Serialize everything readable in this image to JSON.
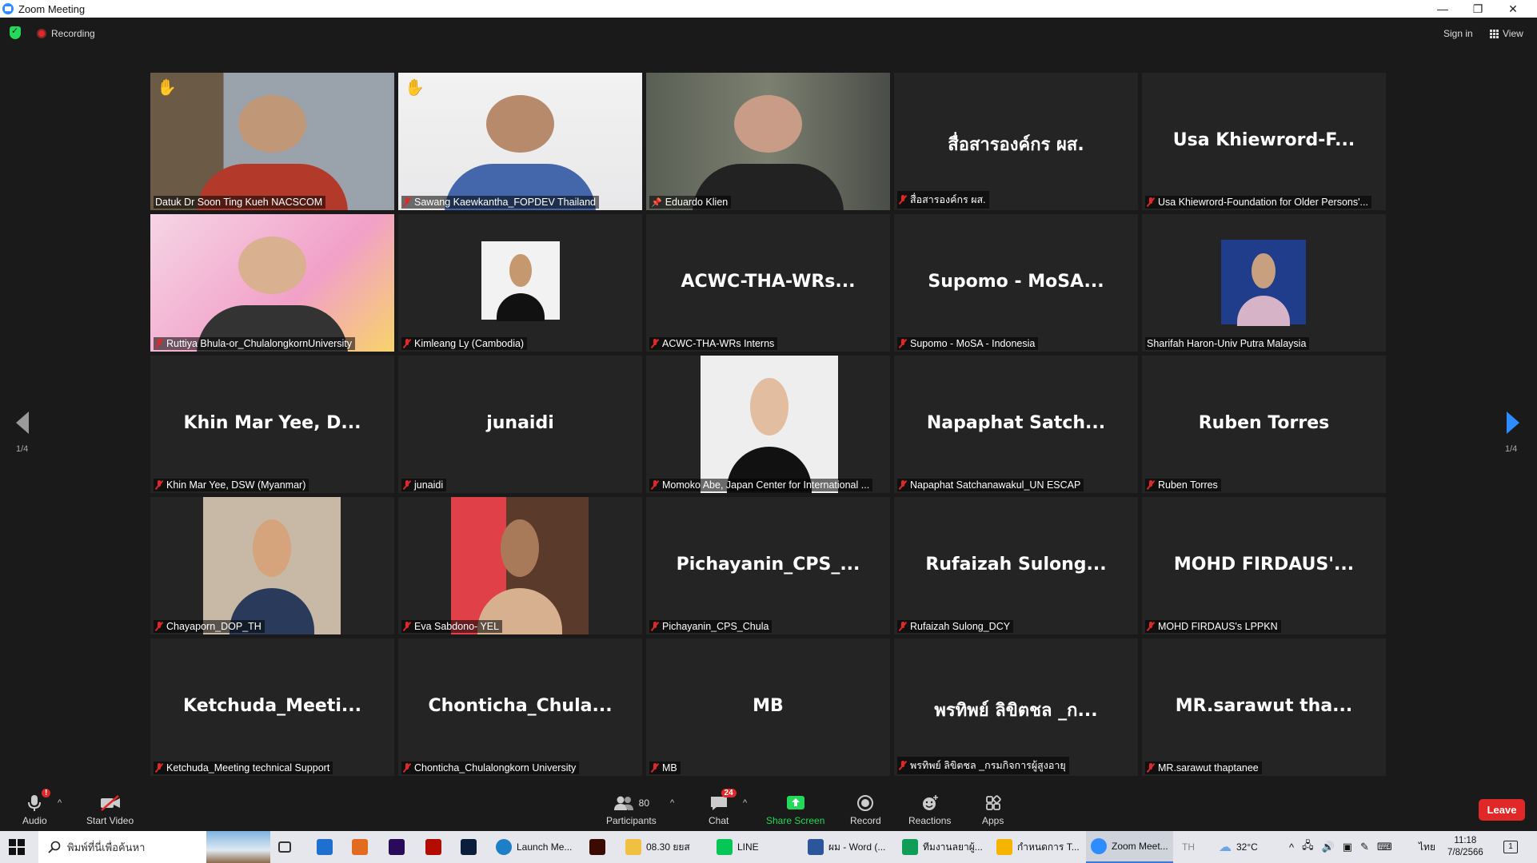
{
  "window": {
    "title": "Zoom Meeting",
    "minimize": "—",
    "restore": "❐",
    "close": "✕"
  },
  "meeting_bar": {
    "recording_label": "Recording",
    "sign_in": "Sign in",
    "view": "View"
  },
  "pager": {
    "left_indicator": "1/4",
    "right_indicator": "1/4"
  },
  "tiles": [
    {
      "name": "Datuk Dr Soon Ting Kueh NACSCOM",
      "display": "",
      "video": true,
      "muted": false,
      "hand": true
    },
    {
      "name": "Sawang Kaewkantha_FOPDEV Thailand",
      "display": "",
      "video": true,
      "muted": true,
      "hand": true
    },
    {
      "name": "Eduardo Klien",
      "display": "",
      "video": true,
      "muted": false,
      "pinned": true,
      "active": true
    },
    {
      "name": "สื่อสารองค์กร ผส.",
      "display": "สื่อสารองค์กร ผส.",
      "video": false,
      "muted": true
    },
    {
      "name": "Usa Khiewrord-Foundation for Older Persons'...",
      "display": "Usa Khiewrord-F...",
      "video": false,
      "muted": true
    },
    {
      "name": "Ruttiya Bhula-or_ChulalongkornUniversity",
      "display": "",
      "video": true,
      "muted": true
    },
    {
      "name": "Kimleang Ly (Cambodia)",
      "display": "",
      "video": true,
      "muted": true
    },
    {
      "name": "ACWC-THA-WRs Interns",
      "display": "ACWC-THA-WRs...",
      "video": false,
      "muted": true
    },
    {
      "name": "Supomo - MoSA - Indonesia",
      "display": "Supomo - MoSA...",
      "video": false,
      "muted": true
    },
    {
      "name": "Sharifah Haron-Univ Putra Malaysia",
      "display": "",
      "video": true,
      "muted": false
    },
    {
      "name": "Khin Mar Yee, DSW (Myanmar)",
      "display": "Khin Mar Yee, D...",
      "video": false,
      "muted": true
    },
    {
      "name": "junaidi",
      "display": "junaidi",
      "video": false,
      "muted": true
    },
    {
      "name": "Momoko Abe, Japan Center for International ...",
      "display": "",
      "video": true,
      "muted": true
    },
    {
      "name": "Napaphat Satchanawakul_UN ESCAP",
      "display": "Napaphat Satch...",
      "video": false,
      "muted": true
    },
    {
      "name": "Ruben Torres",
      "display": "Ruben Torres",
      "video": false,
      "muted": true
    },
    {
      "name": "Chayaporn_DOP_TH",
      "display": "",
      "video": true,
      "muted": true
    },
    {
      "name": "Eva Sabdono- YEL",
      "display": "",
      "video": true,
      "muted": true
    },
    {
      "name": "Pichayanin_CPS_Chula",
      "display": "Pichayanin_CPS_...",
      "video": false,
      "muted": true
    },
    {
      "name": "Rufaizah Sulong_DCY",
      "display": "Rufaizah Sulong...",
      "video": false,
      "muted": true
    },
    {
      "name": "MOHD FIRDAUS's LPPKN",
      "display": "MOHD FIRDAUS'...",
      "video": false,
      "muted": true
    },
    {
      "name": "Ketchuda_Meeting technical Support",
      "display": "Ketchuda_Meeti...",
      "video": false,
      "muted": true
    },
    {
      "name": "Chonticha_Chulalongkorn University",
      "display": "Chonticha_Chula...",
      "video": false,
      "muted": true
    },
    {
      "name": "MB",
      "display": "MB",
      "video": false,
      "muted": true
    },
    {
      "name": "พรทิพย์ ลิขิตชล _กรมกิจการผู้สูงอายุ",
      "display": "พรทิพย์ ลิขิตชล _ก...",
      "video": false,
      "muted": true
    },
    {
      "name": "MR.sarawut thaptanee",
      "display": "MR.sarawut tha...",
      "video": false,
      "muted": true
    }
  ],
  "toolbar": {
    "audio": "Audio",
    "audio_badge": "!",
    "start_video": "Start Video",
    "participants": "Participants",
    "participants_count": "80",
    "chat": "Chat",
    "chat_badge": "24",
    "share_screen": "Share Screen",
    "record": "Record",
    "reactions": "Reactions",
    "apps": "Apps",
    "leave": "Leave"
  },
  "taskbar": {
    "search_placeholder": "พิมพ์ที่นี่เพื่อค้นหา",
    "apps": [
      {
        "label": "Launch Me..."
      },
      {
        "label": "08.30 ยยส"
      },
      {
        "label": "LINE"
      },
      {
        "label": "ผม - Word (..."
      },
      {
        "label": "ทีมงานลยาผู้..."
      },
      {
        "label": "กำหนดการ T..."
      },
      {
        "label": "Zoom Meet..."
      }
    ],
    "lang": "TH",
    "weather": "32°C",
    "ime": "ไทย",
    "time": "11:18",
    "date": "7/8/2566",
    "notif_count": "1"
  },
  "colors": {
    "accent_green": "#23d959",
    "leave_red": "#e02828",
    "active_speaker": "#e5e67a",
    "zoom_blue": "#2d8cff"
  }
}
